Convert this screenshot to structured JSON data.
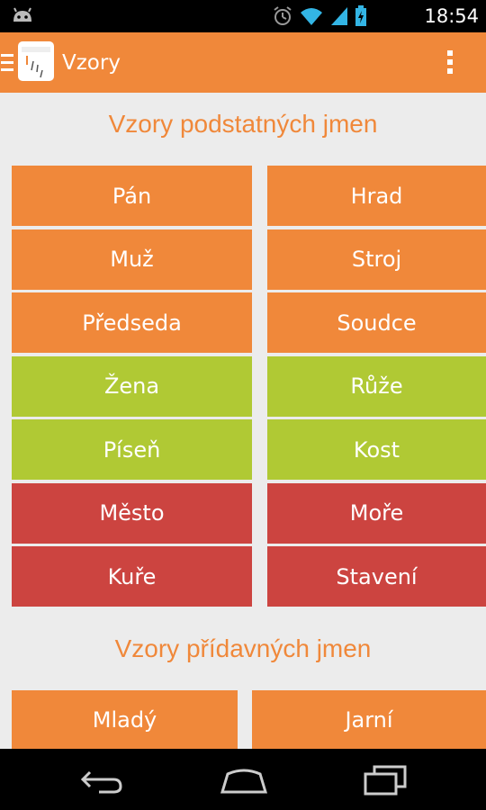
{
  "status_bar": {
    "time": "18:54",
    "icons": [
      "android-icon",
      "alarm-icon",
      "wifi-icon",
      "signal-icon",
      "battery-icon"
    ]
  },
  "action_bar": {
    "title": "Vzory",
    "accent": "#f0883a"
  },
  "nouns": {
    "heading": "Vzory podstatných jmen",
    "rows": [
      {
        "color": "orange",
        "left": "Pán",
        "right": "Hrad"
      },
      {
        "color": "orange",
        "left": "Muž",
        "right": "Stroj"
      },
      {
        "color": "orange",
        "left": "Předseda",
        "right": "Soudce"
      },
      {
        "color": "green",
        "left": "Žena",
        "right": "Růže"
      },
      {
        "color": "green",
        "left": "Píseň",
        "right": "Kost"
      },
      {
        "color": "red",
        "left": "Město",
        "right": "Moře"
      },
      {
        "color": "red",
        "left": "Kuře",
        "right": "Stavení"
      }
    ]
  },
  "adjectives": {
    "heading": "Vzory přídavných jmen",
    "rows": [
      {
        "color": "orange",
        "left": "Mladý",
        "right": "Jarní"
      }
    ]
  },
  "colors": {
    "orange": "#f0883a",
    "green": "#b0c934",
    "red": "#cc4440",
    "background": "#ececec"
  },
  "nav_bar": {
    "buttons": [
      "back-icon",
      "home-icon",
      "recent-apps-icon"
    ]
  }
}
